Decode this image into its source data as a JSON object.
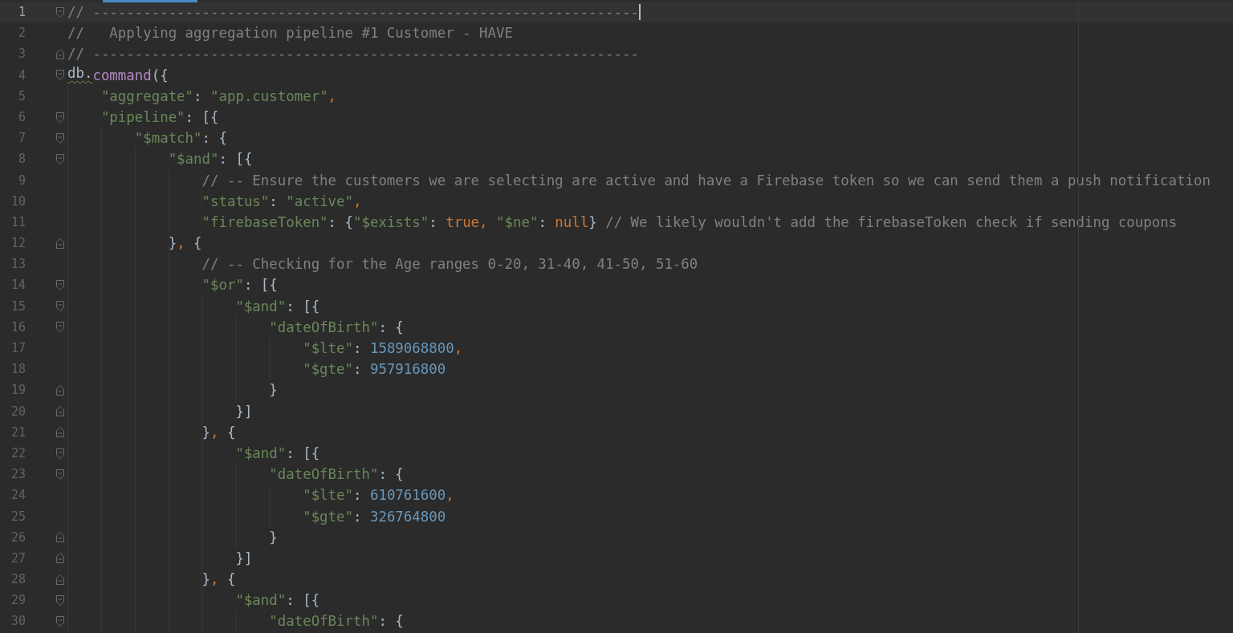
{
  "editor": {
    "lines": [
      {
        "number": "1",
        "current": true,
        "fold_start": true,
        "fold_end": false,
        "tokens": [
          {
            "kind": "comment",
            "text": "// -----------------------------------------------------------------"
          }
        ]
      },
      {
        "number": "2",
        "current": false,
        "fold_start": false,
        "fold_end": false,
        "tokens": [
          {
            "kind": "comment",
            "text": "//   Applying aggregation pipeline #1 Customer - HAVE"
          }
        ]
      },
      {
        "number": "3",
        "current": false,
        "fold_start": false,
        "fold_end": true,
        "tokens": [
          {
            "kind": "comment",
            "text": "// -----------------------------------------------------------------"
          }
        ]
      },
      {
        "number": "4",
        "current": false,
        "fold_start": true,
        "fold_end": false,
        "tokens": [
          {
            "kind": "ident",
            "text": "db.",
            "warning": true
          },
          {
            "kind": "method",
            "text": "command"
          },
          {
            "kind": "punct",
            "text": "({"
          }
        ]
      },
      {
        "number": "5",
        "current": false,
        "fold_start": false,
        "fold_end": false,
        "tokens": [
          {
            "kind": "key",
            "text": "    \"aggregate\""
          },
          {
            "kind": "punct",
            "text": ": "
          },
          {
            "kind": "string",
            "text": "\"app.customer\""
          },
          {
            "kind": "comma",
            "text": ","
          }
        ]
      },
      {
        "number": "6",
        "current": false,
        "fold_start": true,
        "fold_end": false,
        "tokens": [
          {
            "kind": "key",
            "text": "    \"pipeline\""
          },
          {
            "kind": "punct",
            "text": ": [{"
          }
        ]
      },
      {
        "number": "7",
        "current": false,
        "fold_start": true,
        "fold_end": false,
        "tokens": [
          {
            "kind": "key",
            "text": "        \"$match\""
          },
          {
            "kind": "punct",
            "text": ": {"
          }
        ]
      },
      {
        "number": "8",
        "current": false,
        "fold_start": true,
        "fold_end": false,
        "tokens": [
          {
            "kind": "key",
            "text": "            \"$and\""
          },
          {
            "kind": "punct",
            "text": ": [{"
          }
        ]
      },
      {
        "number": "9",
        "current": false,
        "fold_start": false,
        "fold_end": false,
        "tokens": [
          {
            "kind": "comment",
            "text": "                // -- Ensure the customers we are selecting are active and have a Firebase token so we can send them a push notification"
          }
        ]
      },
      {
        "number": "10",
        "current": false,
        "fold_start": false,
        "fold_end": false,
        "tokens": [
          {
            "kind": "key",
            "text": "                \"status\""
          },
          {
            "kind": "punct",
            "text": ": "
          },
          {
            "kind": "string",
            "text": "\"active\""
          },
          {
            "kind": "comma",
            "text": ","
          }
        ]
      },
      {
        "number": "11",
        "current": false,
        "fold_start": false,
        "fold_end": false,
        "tokens": [
          {
            "kind": "key",
            "text": "                \"firebaseToken\""
          },
          {
            "kind": "punct",
            "text": ": {"
          },
          {
            "kind": "key",
            "text": "\"$exists\""
          },
          {
            "kind": "punct",
            "text": ": "
          },
          {
            "kind": "keyword",
            "text": "true"
          },
          {
            "kind": "comma",
            "text": ", "
          },
          {
            "kind": "key",
            "text": "\"$ne\""
          },
          {
            "kind": "punct",
            "text": ": "
          },
          {
            "kind": "keyword",
            "text": "null"
          },
          {
            "kind": "punct",
            "text": "}"
          },
          {
            "kind": "comment",
            "text": " // We likely wouldn't add the firebaseToken check if sending coupons"
          }
        ]
      },
      {
        "number": "12",
        "current": false,
        "fold_start": false,
        "fold_end": true,
        "tokens": [
          {
            "kind": "punct",
            "text": "            }"
          },
          {
            "kind": "comma",
            "text": ", "
          },
          {
            "kind": "punct",
            "text": "{"
          }
        ]
      },
      {
        "number": "13",
        "current": false,
        "fold_start": false,
        "fold_end": false,
        "tokens": [
          {
            "kind": "comment",
            "text": "                // -- Checking for the Age ranges 0-20, 31-40, 41-50, 51-60"
          }
        ]
      },
      {
        "number": "14",
        "current": false,
        "fold_start": true,
        "fold_end": false,
        "tokens": [
          {
            "kind": "key",
            "text": "                \"$or\""
          },
          {
            "kind": "punct",
            "text": ": [{"
          }
        ]
      },
      {
        "number": "15",
        "current": false,
        "fold_start": true,
        "fold_end": false,
        "tokens": [
          {
            "kind": "key",
            "text": "                    \"$and\""
          },
          {
            "kind": "punct",
            "text": ": [{"
          }
        ]
      },
      {
        "number": "16",
        "current": false,
        "fold_start": true,
        "fold_end": false,
        "tokens": [
          {
            "kind": "key",
            "text": "                        \"dateOfBirth\""
          },
          {
            "kind": "punct",
            "text": ": {"
          }
        ]
      },
      {
        "number": "17",
        "current": false,
        "fold_start": false,
        "fold_end": false,
        "tokens": [
          {
            "kind": "key",
            "text": "                            \"$lte\""
          },
          {
            "kind": "punct",
            "text": ": "
          },
          {
            "kind": "number",
            "text": "1589068800"
          },
          {
            "kind": "comma",
            "text": ","
          }
        ]
      },
      {
        "number": "18",
        "current": false,
        "fold_start": false,
        "fold_end": false,
        "tokens": [
          {
            "kind": "key",
            "text": "                            \"$gte\""
          },
          {
            "kind": "punct",
            "text": ": "
          },
          {
            "kind": "number",
            "text": "957916800"
          }
        ]
      },
      {
        "number": "19",
        "current": false,
        "fold_start": false,
        "fold_end": true,
        "tokens": [
          {
            "kind": "punct",
            "text": "                        }"
          }
        ]
      },
      {
        "number": "20",
        "current": false,
        "fold_start": false,
        "fold_end": true,
        "tokens": [
          {
            "kind": "punct",
            "text": "                    }]"
          }
        ]
      },
      {
        "number": "21",
        "current": false,
        "fold_start": false,
        "fold_end": true,
        "tokens": [
          {
            "kind": "punct",
            "text": "                }"
          },
          {
            "kind": "comma",
            "text": ", "
          },
          {
            "kind": "punct",
            "text": "{"
          }
        ]
      },
      {
        "number": "22",
        "current": false,
        "fold_start": true,
        "fold_end": false,
        "tokens": [
          {
            "kind": "key",
            "text": "                    \"$and\""
          },
          {
            "kind": "punct",
            "text": ": [{"
          }
        ]
      },
      {
        "number": "23",
        "current": false,
        "fold_start": true,
        "fold_end": false,
        "tokens": [
          {
            "kind": "key",
            "text": "                        \"dateOfBirth\""
          },
          {
            "kind": "punct",
            "text": ": {"
          }
        ]
      },
      {
        "number": "24",
        "current": false,
        "fold_start": false,
        "fold_end": false,
        "tokens": [
          {
            "kind": "key",
            "text": "                            \"$lte\""
          },
          {
            "kind": "punct",
            "text": ": "
          },
          {
            "kind": "number",
            "text": "610761600"
          },
          {
            "kind": "comma",
            "text": ","
          }
        ]
      },
      {
        "number": "25",
        "current": false,
        "fold_start": false,
        "fold_end": false,
        "tokens": [
          {
            "kind": "key",
            "text": "                            \"$gte\""
          },
          {
            "kind": "punct",
            "text": ": "
          },
          {
            "kind": "number",
            "text": "326764800"
          }
        ]
      },
      {
        "number": "26",
        "current": false,
        "fold_start": false,
        "fold_end": true,
        "tokens": [
          {
            "kind": "punct",
            "text": "                        }"
          }
        ]
      },
      {
        "number": "27",
        "current": false,
        "fold_start": false,
        "fold_end": true,
        "tokens": [
          {
            "kind": "punct",
            "text": "                    }]"
          }
        ]
      },
      {
        "number": "28",
        "current": false,
        "fold_start": false,
        "fold_end": true,
        "tokens": [
          {
            "kind": "punct",
            "text": "                }"
          },
          {
            "kind": "comma",
            "text": ", "
          },
          {
            "kind": "punct",
            "text": "{"
          }
        ]
      },
      {
        "number": "29",
        "current": false,
        "fold_start": true,
        "fold_end": false,
        "tokens": [
          {
            "kind": "key",
            "text": "                    \"$and\""
          },
          {
            "kind": "punct",
            "text": ": [{"
          }
        ]
      },
      {
        "number": "30",
        "current": false,
        "fold_start": true,
        "fold_end": false,
        "tokens": [
          {
            "kind": "key",
            "text": "                        \"dateOfBirth\""
          },
          {
            "kind": "punct",
            "text": ": {"
          }
        ]
      }
    ]
  }
}
